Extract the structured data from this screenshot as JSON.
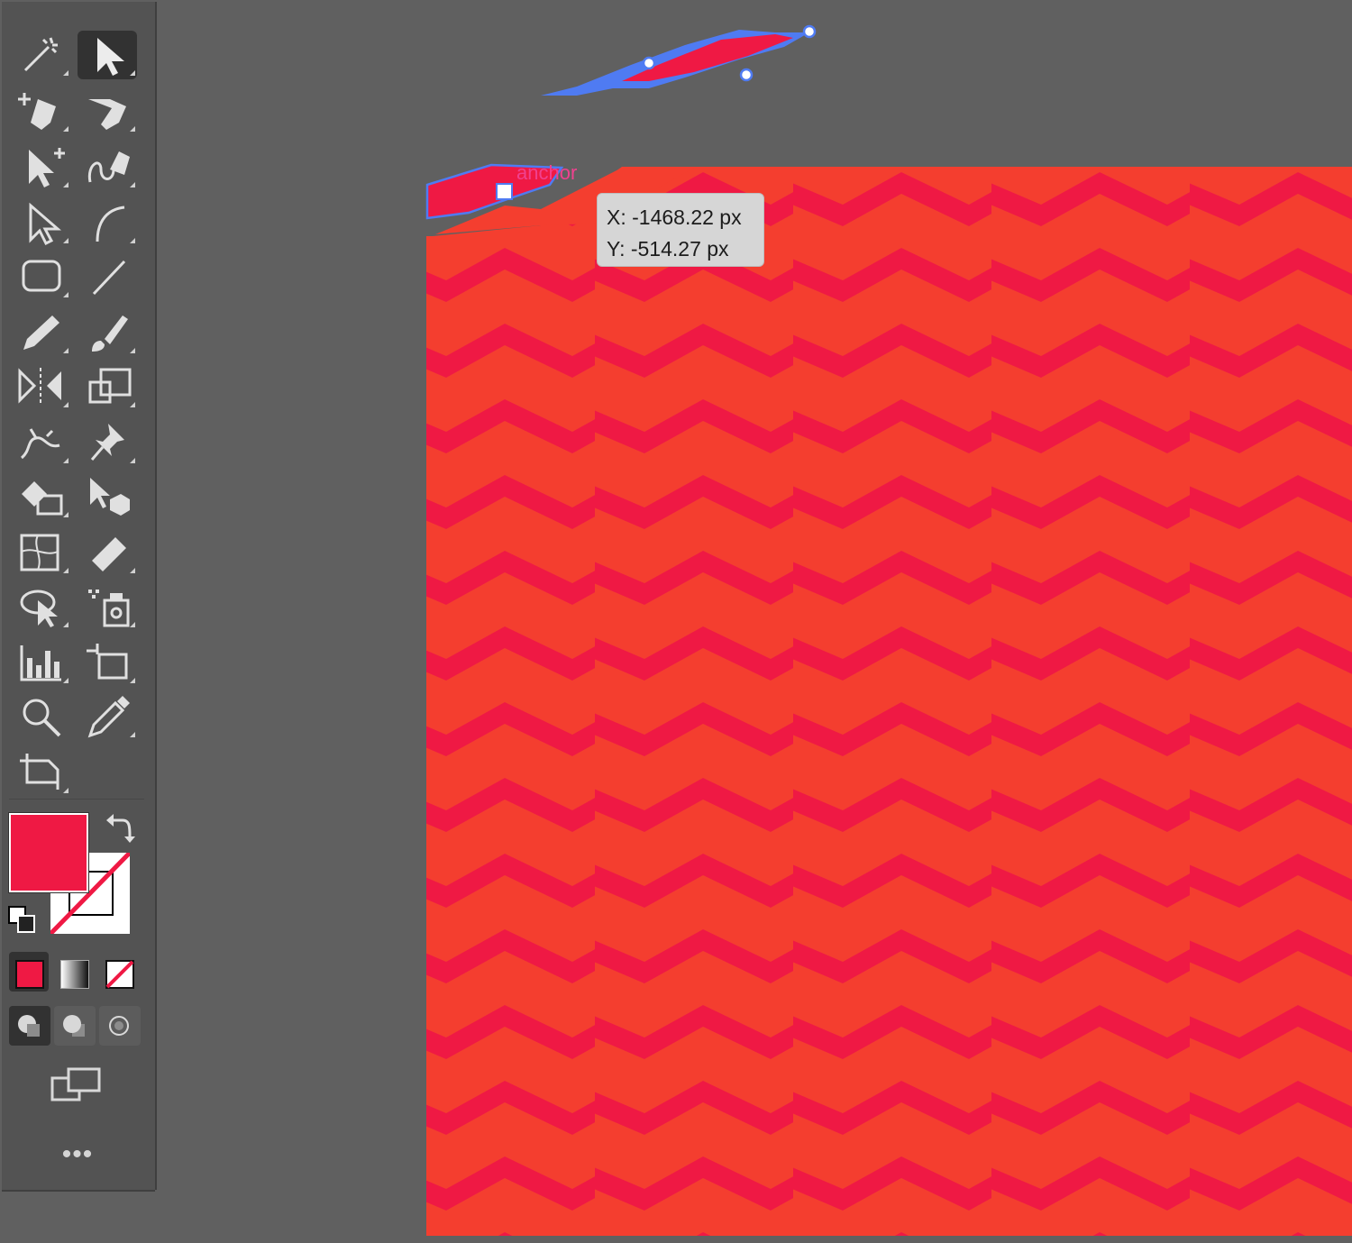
{
  "canvas": {
    "artboard_colors": {
      "base": "#f43e2f",
      "stripe": "#ef1944",
      "selection": "#4f7bf2"
    },
    "smart_guide_label": "anchor",
    "tooltip": {
      "x": "X: -1468.22 px",
      "y": "Y: -514.27 px"
    }
  },
  "toolbar": {
    "tools": [
      {
        "icon": "magic-wand-icon"
      },
      {
        "icon": "selection-arrow-icon",
        "active": true
      },
      {
        "icon": "add-anchor-pen-icon"
      },
      {
        "icon": "anchor-point-icon"
      },
      {
        "icon": "direct-selection-plus-icon"
      },
      {
        "icon": "curvature-pen-icon"
      },
      {
        "icon": "direct-selection-icon"
      },
      {
        "icon": "arc-icon"
      },
      {
        "icon": "rounded-rectangle-icon"
      },
      {
        "icon": "line-segment-icon"
      },
      {
        "icon": "pencil-icon"
      },
      {
        "icon": "paintbrush-icon"
      },
      {
        "icon": "reflect-icon"
      },
      {
        "icon": "scale-icon"
      },
      {
        "icon": "puppet-warp-icon"
      },
      {
        "icon": "pin-icon"
      },
      {
        "icon": "live-paint-icon"
      },
      {
        "icon": "shape-builder-icon"
      },
      {
        "icon": "mesh-icon"
      },
      {
        "icon": "eraser-icon"
      },
      {
        "icon": "lasso-icon"
      },
      {
        "icon": "symbol-sprayer-icon"
      },
      {
        "icon": "column-graph-icon"
      },
      {
        "icon": "artboard-icon"
      },
      {
        "icon": "zoom-icon"
      },
      {
        "icon": "eyedropper-icon"
      },
      {
        "icon": "crop-image-icon"
      }
    ],
    "fill_color": "#ef1944",
    "stroke_color": "none",
    "more_tools": "•••"
  }
}
